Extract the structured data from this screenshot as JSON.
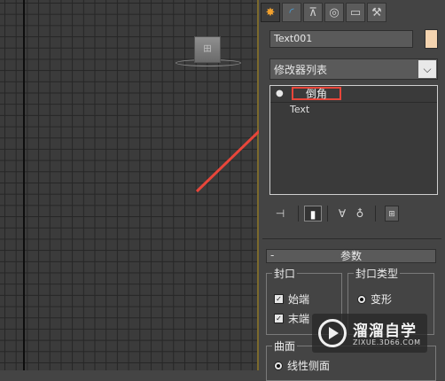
{
  "viewport": {
    "object_label": "田"
  },
  "command_panel": {
    "tabs": [
      {
        "name": "create-tab",
        "icon": "sun-star-icon",
        "glyph": "✸"
      },
      {
        "name": "modify-tab",
        "icon": "curve-icon",
        "glyph": "◜"
      },
      {
        "name": "hierarchy-tab",
        "icon": "hierarchy-icon",
        "glyph": "⊼"
      },
      {
        "name": "motion-tab",
        "icon": "motion-icon",
        "glyph": "◎"
      },
      {
        "name": "display-tab",
        "icon": "monitor-icon",
        "glyph": "▭"
      },
      {
        "name": "utilities-tab",
        "icon": "hammer-icon",
        "glyph": "⚒"
      }
    ],
    "object_name": "Text001",
    "object_color": "#f4d4b0",
    "modifier_list": {
      "label": "修改器列表",
      "dropdown_glyph": "⌵"
    },
    "stack": {
      "items": [
        {
          "label": "倒角",
          "highlight_color": "#e8463a"
        },
        {
          "label": "Text"
        }
      ]
    },
    "stack_tools": {
      "pin_glyph": "⊣",
      "show_end_glyph": "▮",
      "unique_glyph": "∀",
      "remove_glyph": "♁",
      "config_glyph": "⊞"
    },
    "parameters": {
      "title": "参数",
      "collapse_glyph": "-",
      "capping": {
        "title": "封口",
        "start_label": "始端",
        "start_checked": true,
        "end_label": "末端",
        "end_checked": true
      },
      "cap_type": {
        "title": "封口类型",
        "morph_label": "变形",
        "morph_selected": true
      },
      "surface": {
        "title": "曲面",
        "linear_sides_label": "线性侧面",
        "linear_sides_selected": true
      }
    }
  },
  "annotation": {
    "arrow_color": "#e8463a"
  },
  "watermark": {
    "name": "溜溜自学",
    "url": "ZIXUE.3D66.COM"
  }
}
